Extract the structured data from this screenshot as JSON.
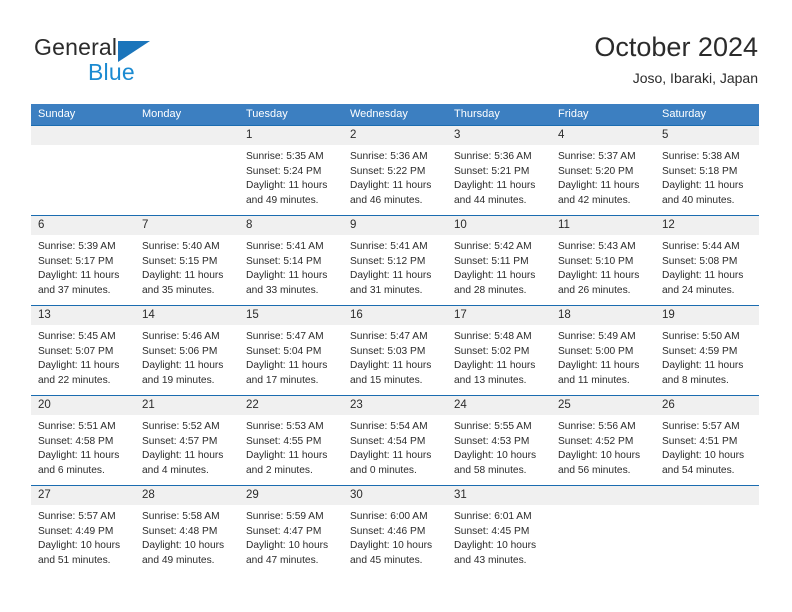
{
  "brand": {
    "name_top": "General",
    "name_bottom": "Blue",
    "accent_color": "#1b75bb",
    "blue_text_color": "#1b8ad1"
  },
  "header": {
    "title": "October 2024",
    "subtitle": "Joso, Ibaraki, Japan",
    "header_bg_color": "#3c7fc1",
    "row_divider_color": "#1b6cb0",
    "daynum_band_color": "#f0f0f0"
  },
  "weekdays": [
    "Sunday",
    "Monday",
    "Tuesday",
    "Wednesday",
    "Thursday",
    "Friday",
    "Saturday"
  ],
  "weeks": [
    [
      {
        "day": "",
        "sunrise": "",
        "sunset": "",
        "daylight_line1": "",
        "daylight_line2": ""
      },
      {
        "day": "",
        "sunrise": "",
        "sunset": "",
        "daylight_line1": "",
        "daylight_line2": ""
      },
      {
        "day": "1",
        "sunrise": "Sunrise: 5:35 AM",
        "sunset": "Sunset: 5:24 PM",
        "daylight_line1": "Daylight: 11 hours",
        "daylight_line2": "and 49 minutes."
      },
      {
        "day": "2",
        "sunrise": "Sunrise: 5:36 AM",
        "sunset": "Sunset: 5:22 PM",
        "daylight_line1": "Daylight: 11 hours",
        "daylight_line2": "and 46 minutes."
      },
      {
        "day": "3",
        "sunrise": "Sunrise: 5:36 AM",
        "sunset": "Sunset: 5:21 PM",
        "daylight_line1": "Daylight: 11 hours",
        "daylight_line2": "and 44 minutes."
      },
      {
        "day": "4",
        "sunrise": "Sunrise: 5:37 AM",
        "sunset": "Sunset: 5:20 PM",
        "daylight_line1": "Daylight: 11 hours",
        "daylight_line2": "and 42 minutes."
      },
      {
        "day": "5",
        "sunrise": "Sunrise: 5:38 AM",
        "sunset": "Sunset: 5:18 PM",
        "daylight_line1": "Daylight: 11 hours",
        "daylight_line2": "and 40 minutes."
      }
    ],
    [
      {
        "day": "6",
        "sunrise": "Sunrise: 5:39 AM",
        "sunset": "Sunset: 5:17 PM",
        "daylight_line1": "Daylight: 11 hours",
        "daylight_line2": "and 37 minutes."
      },
      {
        "day": "7",
        "sunrise": "Sunrise: 5:40 AM",
        "sunset": "Sunset: 5:15 PM",
        "daylight_line1": "Daylight: 11 hours",
        "daylight_line2": "and 35 minutes."
      },
      {
        "day": "8",
        "sunrise": "Sunrise: 5:41 AM",
        "sunset": "Sunset: 5:14 PM",
        "daylight_line1": "Daylight: 11 hours",
        "daylight_line2": "and 33 minutes."
      },
      {
        "day": "9",
        "sunrise": "Sunrise: 5:41 AM",
        "sunset": "Sunset: 5:12 PM",
        "daylight_line1": "Daylight: 11 hours",
        "daylight_line2": "and 31 minutes."
      },
      {
        "day": "10",
        "sunrise": "Sunrise: 5:42 AM",
        "sunset": "Sunset: 5:11 PM",
        "daylight_line1": "Daylight: 11 hours",
        "daylight_line2": "and 28 minutes."
      },
      {
        "day": "11",
        "sunrise": "Sunrise: 5:43 AM",
        "sunset": "Sunset: 5:10 PM",
        "daylight_line1": "Daylight: 11 hours",
        "daylight_line2": "and 26 minutes."
      },
      {
        "day": "12",
        "sunrise": "Sunrise: 5:44 AM",
        "sunset": "Sunset: 5:08 PM",
        "daylight_line1": "Daylight: 11 hours",
        "daylight_line2": "and 24 minutes."
      }
    ],
    [
      {
        "day": "13",
        "sunrise": "Sunrise: 5:45 AM",
        "sunset": "Sunset: 5:07 PM",
        "daylight_line1": "Daylight: 11 hours",
        "daylight_line2": "and 22 minutes."
      },
      {
        "day": "14",
        "sunrise": "Sunrise: 5:46 AM",
        "sunset": "Sunset: 5:06 PM",
        "daylight_line1": "Daylight: 11 hours",
        "daylight_line2": "and 19 minutes."
      },
      {
        "day": "15",
        "sunrise": "Sunrise: 5:47 AM",
        "sunset": "Sunset: 5:04 PM",
        "daylight_line1": "Daylight: 11 hours",
        "daylight_line2": "and 17 minutes."
      },
      {
        "day": "16",
        "sunrise": "Sunrise: 5:47 AM",
        "sunset": "Sunset: 5:03 PM",
        "daylight_line1": "Daylight: 11 hours",
        "daylight_line2": "and 15 minutes."
      },
      {
        "day": "17",
        "sunrise": "Sunrise: 5:48 AM",
        "sunset": "Sunset: 5:02 PM",
        "daylight_line1": "Daylight: 11 hours",
        "daylight_line2": "and 13 minutes."
      },
      {
        "day": "18",
        "sunrise": "Sunrise: 5:49 AM",
        "sunset": "Sunset: 5:00 PM",
        "daylight_line1": "Daylight: 11 hours",
        "daylight_line2": "and 11 minutes."
      },
      {
        "day": "19",
        "sunrise": "Sunrise: 5:50 AM",
        "sunset": "Sunset: 4:59 PM",
        "daylight_line1": "Daylight: 11 hours",
        "daylight_line2": "and 8 minutes."
      }
    ],
    [
      {
        "day": "20",
        "sunrise": "Sunrise: 5:51 AM",
        "sunset": "Sunset: 4:58 PM",
        "daylight_line1": "Daylight: 11 hours",
        "daylight_line2": "and 6 minutes."
      },
      {
        "day": "21",
        "sunrise": "Sunrise: 5:52 AM",
        "sunset": "Sunset: 4:57 PM",
        "daylight_line1": "Daylight: 11 hours",
        "daylight_line2": "and 4 minutes."
      },
      {
        "day": "22",
        "sunrise": "Sunrise: 5:53 AM",
        "sunset": "Sunset: 4:55 PM",
        "daylight_line1": "Daylight: 11 hours",
        "daylight_line2": "and 2 minutes."
      },
      {
        "day": "23",
        "sunrise": "Sunrise: 5:54 AM",
        "sunset": "Sunset: 4:54 PM",
        "daylight_line1": "Daylight: 11 hours",
        "daylight_line2": "and 0 minutes."
      },
      {
        "day": "24",
        "sunrise": "Sunrise: 5:55 AM",
        "sunset": "Sunset: 4:53 PM",
        "daylight_line1": "Daylight: 10 hours",
        "daylight_line2": "and 58 minutes."
      },
      {
        "day": "25",
        "sunrise": "Sunrise: 5:56 AM",
        "sunset": "Sunset: 4:52 PM",
        "daylight_line1": "Daylight: 10 hours",
        "daylight_line2": "and 56 minutes."
      },
      {
        "day": "26",
        "sunrise": "Sunrise: 5:57 AM",
        "sunset": "Sunset: 4:51 PM",
        "daylight_line1": "Daylight: 10 hours",
        "daylight_line2": "and 54 minutes."
      }
    ],
    [
      {
        "day": "27",
        "sunrise": "Sunrise: 5:57 AM",
        "sunset": "Sunset: 4:49 PM",
        "daylight_line1": "Daylight: 10 hours",
        "daylight_line2": "and 51 minutes."
      },
      {
        "day": "28",
        "sunrise": "Sunrise: 5:58 AM",
        "sunset": "Sunset: 4:48 PM",
        "daylight_line1": "Daylight: 10 hours",
        "daylight_line2": "and 49 minutes."
      },
      {
        "day": "29",
        "sunrise": "Sunrise: 5:59 AM",
        "sunset": "Sunset: 4:47 PM",
        "daylight_line1": "Daylight: 10 hours",
        "daylight_line2": "and 47 minutes."
      },
      {
        "day": "30",
        "sunrise": "Sunrise: 6:00 AM",
        "sunset": "Sunset: 4:46 PM",
        "daylight_line1": "Daylight: 10 hours",
        "daylight_line2": "and 45 minutes."
      },
      {
        "day": "31",
        "sunrise": "Sunrise: 6:01 AM",
        "sunset": "Sunset: 4:45 PM",
        "daylight_line1": "Daylight: 10 hours",
        "daylight_line2": "and 43 minutes."
      },
      {
        "day": "",
        "sunrise": "",
        "sunset": "",
        "daylight_line1": "",
        "daylight_line2": ""
      },
      {
        "day": "",
        "sunrise": "",
        "sunset": "",
        "daylight_line1": "",
        "daylight_line2": ""
      }
    ]
  ]
}
